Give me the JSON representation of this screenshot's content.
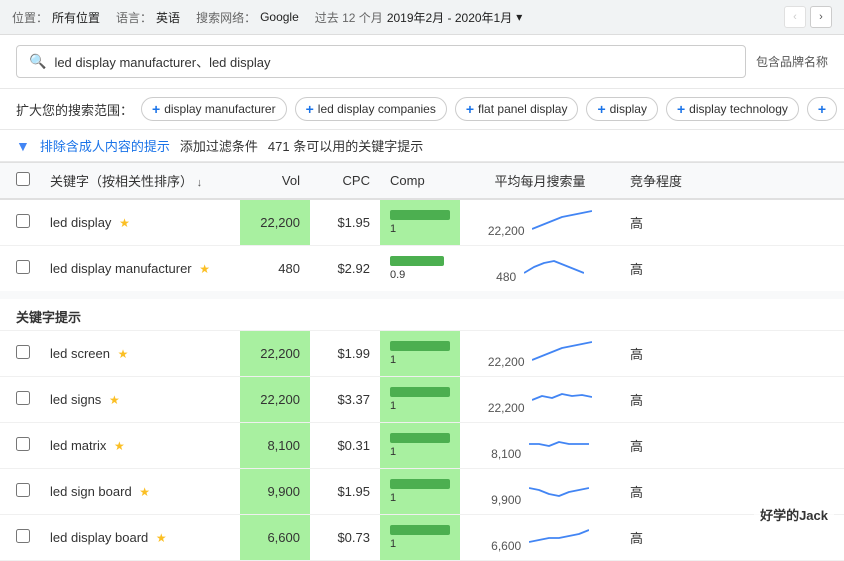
{
  "topbar": {
    "location_label": "位置：",
    "location_value": "所有位置",
    "language_label": "语言：",
    "language_value": "英语",
    "network_label": "搜索网络：",
    "network_value": "Google",
    "period_label": "过去 12 个月",
    "period_value": "2019年2月 - 2020年1月"
  },
  "search": {
    "query": "led display manufacturer、led display",
    "brand_label": "包含品牌名称"
  },
  "expand": {
    "label": "扩大您的搜索范围：",
    "chips": [
      "display manufacturer",
      "led display companies",
      "flat panel display",
      "display",
      "display technology"
    ],
    "more": "+"
  },
  "filter": {
    "exclude_link": "排除含成人内容的提示",
    "add_filter": "添加过滤条件",
    "count": "471 条可以用的关键字提示"
  },
  "table": {
    "headers": {
      "check": "",
      "keyword": "关键字（按相关性排序）",
      "vol": "Vol",
      "cpc": "CPC",
      "comp": "Comp",
      "monthly": "平均每月搜索量",
      "competition": "竞争程度"
    },
    "seed_rows": [
      {
        "keyword": "led display",
        "star": true,
        "vol": "22,200",
        "cpc": "$1.95",
        "comp": "1",
        "comp_width": 60,
        "monthly": "22,200",
        "competition": "高",
        "green": true,
        "sparkline_type": "uptrend"
      },
      {
        "keyword": "led display manufacturer",
        "star": true,
        "vol": "480",
        "cpc": "$2.92",
        "comp": "0.9",
        "comp_width": 54,
        "monthly": "480",
        "competition": "高",
        "green": false,
        "sparkline_type": "hump"
      }
    ],
    "section_label": "关键字提示",
    "suggestion_rows": [
      {
        "keyword": "led screen",
        "star": true,
        "vol": "22,200",
        "cpc": "$1.99",
        "comp": "1",
        "comp_width": 60,
        "monthly": "22,200",
        "competition": "高",
        "green": true,
        "sparkline_type": "uptrend"
      },
      {
        "keyword": "led signs",
        "star": true,
        "vol": "22,200",
        "cpc": "$3.37",
        "comp": "1",
        "comp_width": 60,
        "monthly": "22,200",
        "competition": "高",
        "green": true,
        "sparkline_type": "flat"
      },
      {
        "keyword": "led matrix",
        "star": true,
        "vol": "8,100",
        "cpc": "$0.31",
        "comp": "1",
        "comp_width": 60,
        "monthly": "8,100",
        "competition": "高",
        "green": true,
        "sparkline_type": "flat2"
      },
      {
        "keyword": "led sign board",
        "star": true,
        "vol": "9,900",
        "cpc": "$1.95",
        "comp": "1",
        "comp_width": 60,
        "monthly": "9,900",
        "competition": "高",
        "green": true,
        "sparkline_type": "dip"
      },
      {
        "keyword": "led display board",
        "star": true,
        "vol": "6,600",
        "cpc": "$0.73",
        "comp": "1",
        "comp_width": 60,
        "monthly": "6,600",
        "competition": "高",
        "green": true,
        "sparkline_type": "uptick"
      }
    ]
  },
  "watermark": "好学的Jack"
}
